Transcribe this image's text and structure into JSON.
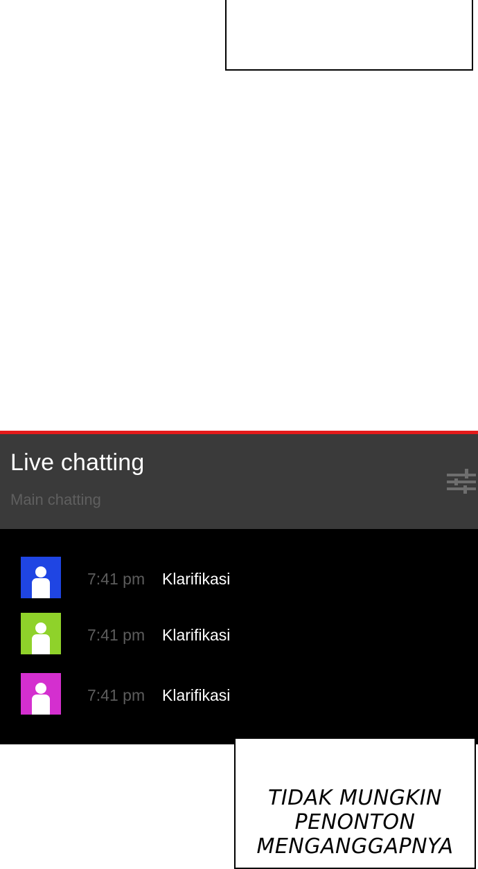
{
  "chat": {
    "title": "Live chatting",
    "subtitle": "Main chatting",
    "filter_icon": "sliders-icon",
    "colors": {
      "accent_line": "#e41b1b",
      "header_bg": "#3a3a3a",
      "messages_bg": "#000000",
      "time_text": "#5c5c5c",
      "message_text": "#ffffff"
    },
    "messages": [
      {
        "avatar_icon": "user-icon",
        "avatar_color": "#1f45e3",
        "time": "7:41 pm",
        "text": "Klarifikasi"
      },
      {
        "avatar_icon": "user-icon",
        "avatar_color": "#8fd22a",
        "time": "7:41 pm",
        "text": "Klarifikasi"
      },
      {
        "avatar_icon": "user-icon",
        "avatar_color": "#d42fcf",
        "time": "7:41 pm",
        "text": "Klarifikasi"
      }
    ]
  },
  "comic": {
    "caption_lines": [
      "TIDAK MUNGKIN",
      "PENONTON",
      "MENGANGGAPNYA"
    ]
  }
}
